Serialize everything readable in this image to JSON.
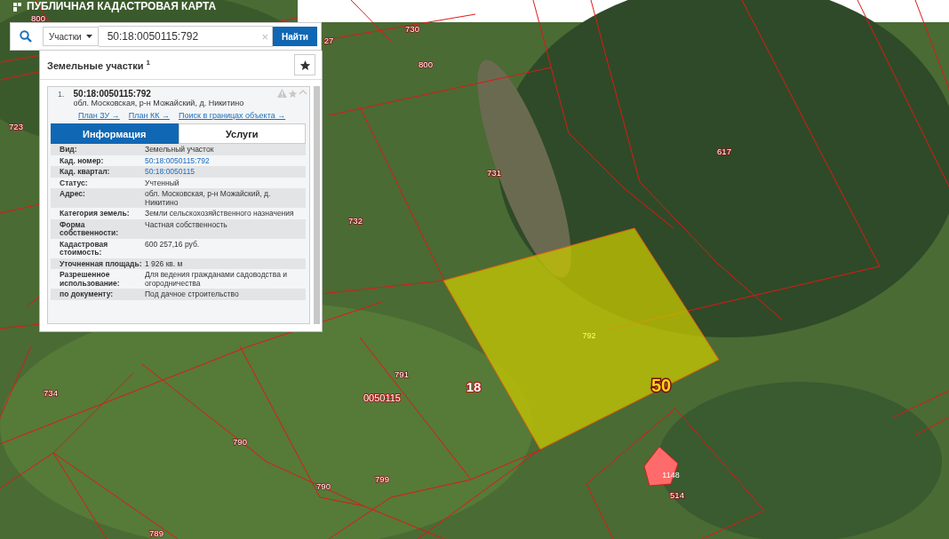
{
  "header": {
    "title": "ПУБЛИЧНАЯ КАДАСТРОВАЯ КАРТА"
  },
  "search": {
    "category": "Участки",
    "value": "50:18:0050115:792",
    "clear": "×",
    "button": "Найти"
  },
  "results": {
    "heading": "Земельные участки $^{1}$",
    "items": [
      {
        "number": "1.",
        "cadastral_number": "50:18:0050115:792",
        "address": "обл. Московская, р-н Можайский, д. Никитино",
        "links": [
          "План ЗУ →",
          "План КК →",
          "Поиск в границах объекта →"
        ],
        "tabs": [
          {
            "label": "Информация",
            "selected": true
          },
          {
            "label": "Услуги",
            "selected": false
          }
        ],
        "rows": [
          {
            "label": "Вид:",
            "value": "Земельный участок",
            "link": false
          },
          {
            "label": "Кад. номер:",
            "value": "50:18:0050115:792",
            "link": true
          },
          {
            "label": "Кад. квартал:",
            "value": "50:18:0050115",
            "link": true
          },
          {
            "label": "Статус:",
            "value": "Учтенный",
            "link": false
          },
          {
            "label": "Адрес:",
            "value": "обл. Московская, р-н Можайский, д. Никитино",
            "link": false
          },
          {
            "label": "Категория земель:",
            "value": "Земли сельскохозяйственного назначения",
            "link": false
          },
          {
            "label": "Форма собственности:",
            "value": "Частная собственность",
            "link": false
          },
          {
            "label": "Кадастровая стоимость:",
            "value": "600 257,16 руб.",
            "link": false
          },
          {
            "label": "Уточненная площадь:",
            "value": "1 926 кв. м",
            "link": false
          },
          {
            "label": "Разрешенное использование:",
            "value": "Для ведения гражданами садоводства и огородничества",
            "link": false
          },
          {
            "label": "по документу:",
            "value": "Под дачное строительство",
            "link": false
          }
        ]
      }
    ]
  },
  "map_labels": [
    {
      "text": "800",
      "kind": "parcel"
    },
    {
      "text": "27",
      "kind": "parcel"
    },
    {
      "text": "730",
      "kind": "parcel"
    },
    {
      "text": "800",
      "kind": "parcel"
    },
    {
      "text": "723",
      "kind": "parcel"
    },
    {
      "text": "731",
      "kind": "parcel"
    },
    {
      "text": "617",
      "kind": "parcel"
    },
    {
      "text": "732",
      "kind": "parcel"
    },
    {
      "text": "792",
      "kind": "selected"
    },
    {
      "text": "791",
      "kind": "parcel"
    },
    {
      "text": "18",
      "kind": "district"
    },
    {
      "text": "0050115",
      "kind": "quarter"
    },
    {
      "text": "50",
      "kind": "region"
    },
    {
      "text": "734",
      "kind": "parcel"
    },
    {
      "text": "790",
      "kind": "parcel"
    },
    {
      "text": "790",
      "kind": "parcel"
    },
    {
      "text": "799",
      "kind": "parcel"
    },
    {
      "text": "789",
      "kind": "parcel"
    },
    {
      "text": "1148",
      "kind": "building"
    },
    {
      "text": "514",
      "kind": "parcel"
    }
  ]
}
